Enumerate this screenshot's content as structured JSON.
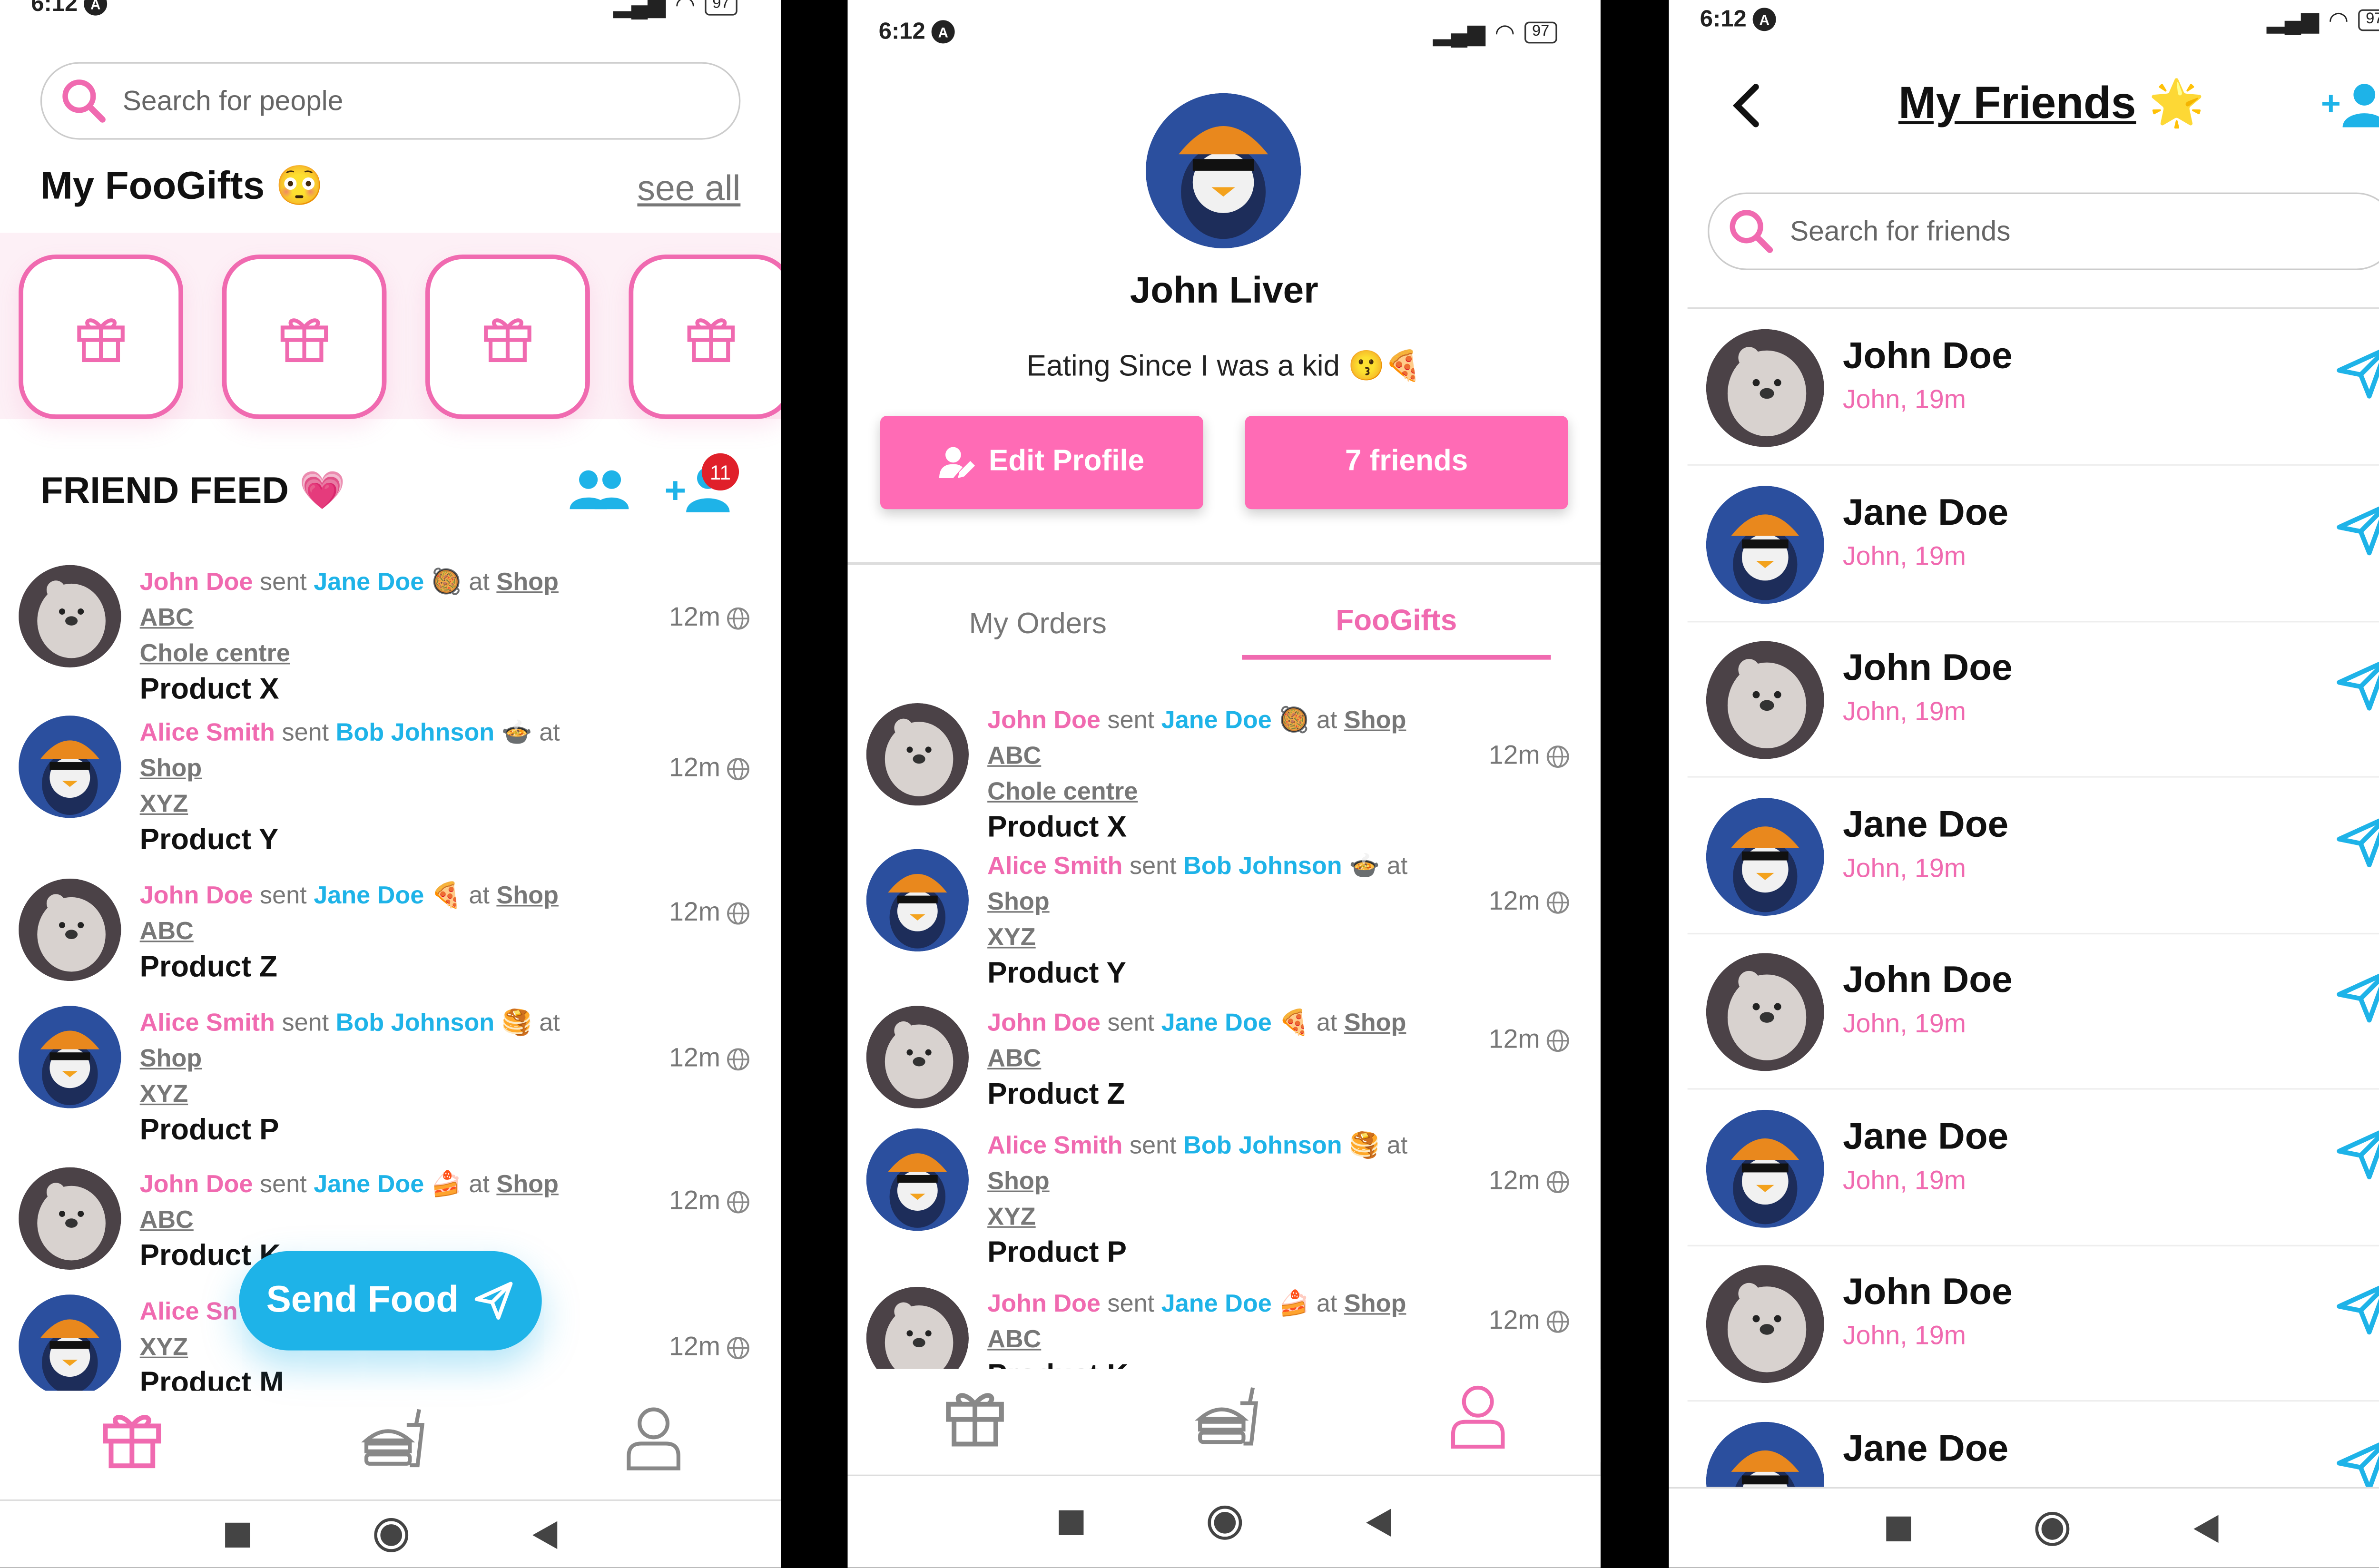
{
  "status": {
    "time": "6:12",
    "battery": "97"
  },
  "screen1": {
    "search_placeholder": "Search for people",
    "foogifts_title": "My FooGifts",
    "foogifts_emoji": "😳",
    "see_all": "see all",
    "feed_title": "FRIEND FEED",
    "feed_emoji": "💗",
    "friend_request_badge": "11",
    "send_food_label": "Send Food",
    "feed": [
      {
        "from": "John Doe",
        "to": "Jane Doe",
        "emoji": "🥘",
        "shop": "Shop ABC",
        "shop2": "Chole centre",
        "product": "Product X",
        "time": "12m",
        "avatar": "bear"
      },
      {
        "from": "Alice Smith",
        "to": "Bob Johnson",
        "emoji": "🍲",
        "shop": "Shop",
        "shop2": "XYZ",
        "product": "Product Y",
        "time": "12m",
        "avatar": "penguin"
      },
      {
        "from": "John Doe",
        "to": "Jane Doe",
        "emoji": "🍕",
        "shop": "Shop ABC",
        "shop2": "",
        "product": "Product Z",
        "time": "12m",
        "avatar": "bear"
      },
      {
        "from": "Alice Smith",
        "to": "Bob Johnson",
        "emoji": "🥞",
        "shop": "Shop",
        "shop2": "XYZ",
        "product": "Product P",
        "time": "12m",
        "avatar": "penguin"
      },
      {
        "from": "John Doe",
        "to": "Jane Doe",
        "emoji": "🍰",
        "shop": "Shop ABC",
        "shop2": "",
        "product": "Product K",
        "time": "12m",
        "avatar": "bear"
      },
      {
        "from": "Alice Sn",
        "to": "",
        "emoji": "",
        "shop": "Shop",
        "shop2": "XYZ",
        "product": "Product M",
        "time": "12m",
        "avatar": "penguin"
      }
    ]
  },
  "screen2": {
    "name": "John Liver",
    "bio": "Eating Since I was a kid",
    "bio_emoji": "😗🍕",
    "edit_profile": "Edit Profile",
    "friends_button": "7 friends",
    "tab_orders": "My Orders",
    "tab_foogifts": "FooGifts",
    "feed": [
      {
        "from": "John Doe",
        "to": "Jane Doe",
        "emoji": "🥘",
        "shop": "Shop ABC",
        "shop2": "Chole centre",
        "product": "Product X",
        "time": "12m",
        "avatar": "bear"
      },
      {
        "from": "Alice Smith",
        "to": "Bob Johnson",
        "emoji": "🍲",
        "shop": "Shop",
        "shop2": "XYZ",
        "product": "Product Y",
        "time": "12m",
        "avatar": "penguin"
      },
      {
        "from": "John Doe",
        "to": "Jane Doe",
        "emoji": "🍕",
        "shop": "Shop ABC",
        "shop2": "",
        "product": "Product Z",
        "time": "12m",
        "avatar": "bear"
      },
      {
        "from": "Alice Smith",
        "to": "Bob Johnson",
        "emoji": "🥞",
        "shop": "Shop",
        "shop2": "XYZ",
        "product": "Product P",
        "time": "12m",
        "avatar": "penguin"
      },
      {
        "from": "John Doe",
        "to": "Jane Doe",
        "emoji": "🍰",
        "shop": "Shop ABC",
        "shop2": "",
        "product": "Product K",
        "time": "12m",
        "avatar": "bear"
      }
    ]
  },
  "screen3": {
    "title": "My Friends",
    "title_emoji": "🌟",
    "search_placeholder": "Search for friends",
    "friends": [
      {
        "name": "John Doe",
        "sub": "John, 19m",
        "avatar": "bear"
      },
      {
        "name": "Jane Doe",
        "sub": "John, 19m",
        "avatar": "penguin"
      },
      {
        "name": "John Doe",
        "sub": "John, 19m",
        "avatar": "bear"
      },
      {
        "name": "Jane Doe",
        "sub": "John, 19m",
        "avatar": "penguin"
      },
      {
        "name": "John Doe",
        "sub": "John, 19m",
        "avatar": "bear"
      },
      {
        "name": "Jane Doe",
        "sub": "John, 19m",
        "avatar": "penguin"
      },
      {
        "name": "John Doe",
        "sub": "John, 19m",
        "avatar": "bear"
      },
      {
        "name": "Jane Doe",
        "sub": "",
        "avatar": "penguin"
      }
    ]
  },
  "colors": {
    "pink": "#f06ab0",
    "blue": "#1eb3e8",
    "button_pink": "#ff6bb5"
  }
}
